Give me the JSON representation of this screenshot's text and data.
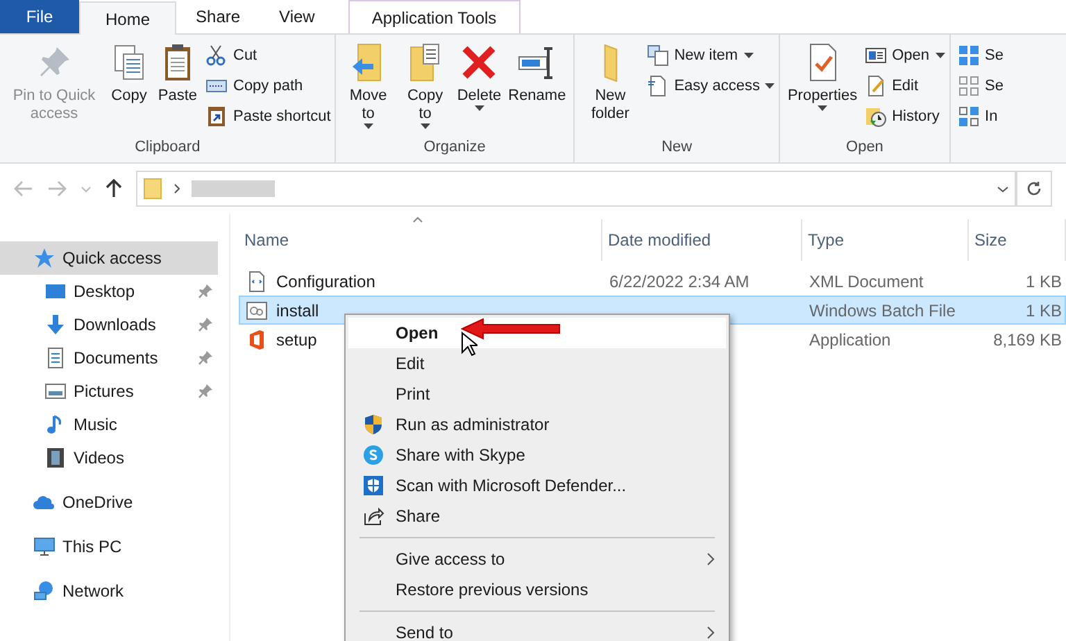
{
  "ribbon": {
    "tabs": [
      {
        "label": "File",
        "kind": "file",
        "selected": false
      },
      {
        "label": "Home",
        "kind": "normal",
        "selected": true
      },
      {
        "label": "Share",
        "kind": "normal",
        "selected": false
      },
      {
        "label": "View",
        "kind": "normal",
        "selected": false
      },
      {
        "label": "Application Tools",
        "kind": "contextual",
        "selected": false
      }
    ],
    "groups": [
      {
        "label": "Clipboard",
        "large": [
          {
            "label": "Pin to Quick access",
            "disabled": true,
            "dropdown": false
          },
          {
            "label": "Copy",
            "disabled": false,
            "dropdown": false
          },
          {
            "label": "Paste",
            "disabled": false,
            "dropdown": false
          }
        ],
        "small": [
          {
            "label": "Cut",
            "dropdown": false
          },
          {
            "label": "Copy path",
            "dropdown": false
          },
          {
            "label": "Paste shortcut",
            "dropdown": false
          }
        ]
      },
      {
        "label": "Organize",
        "large": [
          {
            "label": "Move to",
            "disabled": false,
            "dropdown": true
          },
          {
            "label": "Copy to",
            "disabled": false,
            "dropdown": true
          },
          {
            "label": "Delete",
            "disabled": false,
            "dropdown": true
          },
          {
            "label": "Rename",
            "disabled": false,
            "dropdown": false
          }
        ]
      },
      {
        "label": "New",
        "large": [
          {
            "label": "New folder",
            "disabled": false,
            "dropdown": false
          }
        ],
        "small": [
          {
            "label": "New item",
            "dropdown": true
          },
          {
            "label": "Easy access",
            "dropdown": true
          }
        ]
      },
      {
        "label": "Open",
        "large": [
          {
            "label": "Properties",
            "disabled": false,
            "dropdown": true
          }
        ],
        "small": [
          {
            "label": "Open",
            "dropdown": true
          },
          {
            "label": "Edit",
            "dropdown": false
          },
          {
            "label": "History",
            "dropdown": false
          }
        ]
      },
      {
        "small": [
          {
            "label": "Se"
          },
          {
            "label": "Se"
          },
          {
            "label": "In"
          }
        ]
      }
    ]
  },
  "nav": [
    {
      "label": "Quick access",
      "kind": "section",
      "selected": true,
      "pinned": false
    },
    {
      "label": "Desktop",
      "kind": "sub",
      "selected": false,
      "pinned": true
    },
    {
      "label": "Downloads",
      "kind": "sub",
      "selected": false,
      "pinned": true
    },
    {
      "label": "Documents",
      "kind": "sub",
      "selected": false,
      "pinned": true
    },
    {
      "label": "Pictures",
      "kind": "sub",
      "selected": false,
      "pinned": true
    },
    {
      "label": "Music",
      "kind": "sub",
      "selected": false,
      "pinned": false
    },
    {
      "label": "Videos",
      "kind": "sub",
      "selected": false,
      "pinned": false
    },
    {
      "label": "OneDrive",
      "kind": "section",
      "selected": false,
      "pinned": false
    },
    {
      "label": "This PC",
      "kind": "section",
      "selected": false,
      "pinned": false
    },
    {
      "label": "Network",
      "kind": "section",
      "selected": false,
      "pinned": false
    }
  ],
  "table": {
    "columns": [
      "Name",
      "Date modified",
      "Type",
      "Size"
    ],
    "rows": [
      {
        "name": "Configuration",
        "date": "6/22/2022 2:34 AM",
        "type": "XML Document",
        "size": "1 KB",
        "selected": false
      },
      {
        "name": "install",
        "type": "Windows Batch File",
        "size": "1 KB",
        "selected": true
      },
      {
        "name": "setup",
        "type": "Application",
        "size": "8,169 KB",
        "selected": false
      }
    ]
  },
  "context_menu": [
    {
      "kind": "item",
      "label": "Open",
      "default": true,
      "submenu": false
    },
    {
      "kind": "item",
      "label": "Edit",
      "default": false,
      "submenu": false
    },
    {
      "kind": "item",
      "label": "Print",
      "default": false,
      "submenu": false
    },
    {
      "kind": "item",
      "label": "Run as administrator",
      "default": false,
      "submenu": false
    },
    {
      "kind": "item",
      "label": "Share with Skype",
      "default": false,
      "submenu": false
    },
    {
      "kind": "item",
      "label": "Scan with Microsoft Defender...",
      "default": false,
      "submenu": false
    },
    {
      "kind": "item",
      "label": "Share",
      "default": false,
      "submenu": false
    },
    {
      "kind": "separator"
    },
    {
      "kind": "item",
      "label": "Give access to",
      "default": false,
      "submenu": true
    },
    {
      "kind": "item",
      "label": "Restore previous versions",
      "default": false,
      "submenu": false
    },
    {
      "kind": "separator"
    },
    {
      "kind": "item",
      "label": "Send to",
      "default": false,
      "submenu": true
    }
  ]
}
